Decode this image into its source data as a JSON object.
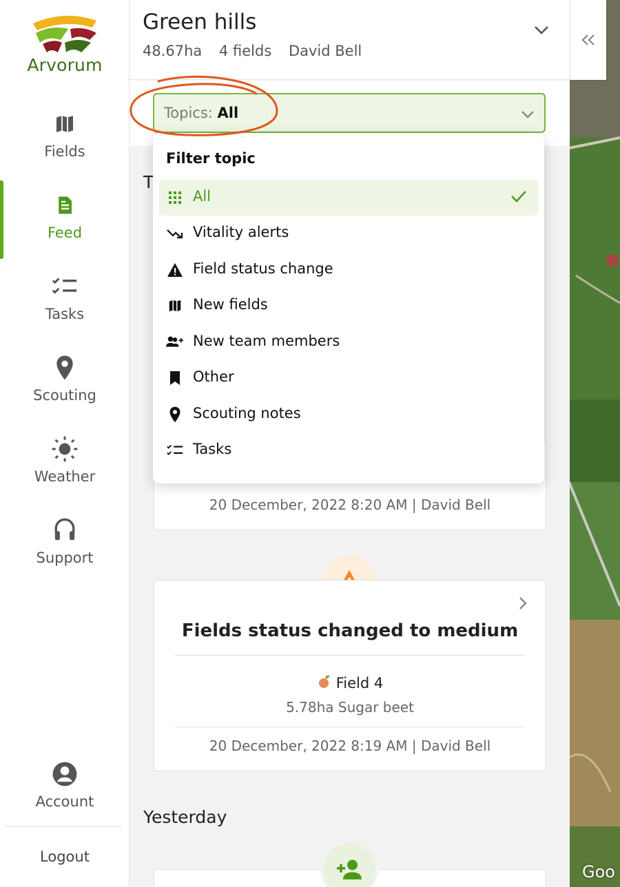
{
  "sidebar": {
    "logo_text": "Arvorum",
    "nav": [
      {
        "label": "Fields",
        "icon": "map-icon"
      },
      {
        "label": "Feed",
        "icon": "document-icon",
        "active": true
      },
      {
        "label": "Tasks",
        "icon": "checklist-icon"
      },
      {
        "label": "Scouting",
        "icon": "map-pin-icon"
      },
      {
        "label": "Weather",
        "icon": "sun-icon"
      },
      {
        "label": "Support",
        "icon": "headset-icon"
      },
      {
        "label": "Account",
        "icon": "account-circle-icon"
      }
    ],
    "logout": "Logout"
  },
  "header": {
    "farm_name": "Green hills",
    "area": "48.67ha",
    "fields_count": "4 fields",
    "owner": "David Bell"
  },
  "filter": {
    "prefix": "Topics:",
    "value": "All"
  },
  "dropdown": {
    "title": "Filter topic",
    "items": [
      {
        "label": "All",
        "icon": "grid-icon",
        "selected": true
      },
      {
        "label": "Vitality alerts",
        "icon": "trending-down-icon"
      },
      {
        "label": "Field status change",
        "icon": "warning-icon"
      },
      {
        "label": "New fields",
        "icon": "map-icon"
      },
      {
        "label": "New team members",
        "icon": "person-add-icon"
      },
      {
        "label": "Other",
        "icon": "bookmark-icon"
      },
      {
        "label": "Scouting notes",
        "icon": "map-pin-icon"
      },
      {
        "label": "Tasks",
        "icon": "checklist-icon"
      }
    ]
  },
  "feed": {
    "today_heading": "T",
    "card1": {
      "meta": "20 December, 2022 8:20 AM | David Bell"
    },
    "card2": {
      "title": "Fields status changed to medium",
      "field": "Field 4",
      "details": "5.78ha Sugar beet",
      "meta": "20 December, 2022 8:19 AM | David Bell"
    },
    "yesterday_heading": "Yesterday"
  },
  "map": {
    "credit": "Goo"
  },
  "colors": {
    "brand_green": "#4c9a17",
    "selected_bg": "#eef5e5",
    "warning_orange": "#f08a24",
    "highlight_annotation": "#e0561b"
  }
}
